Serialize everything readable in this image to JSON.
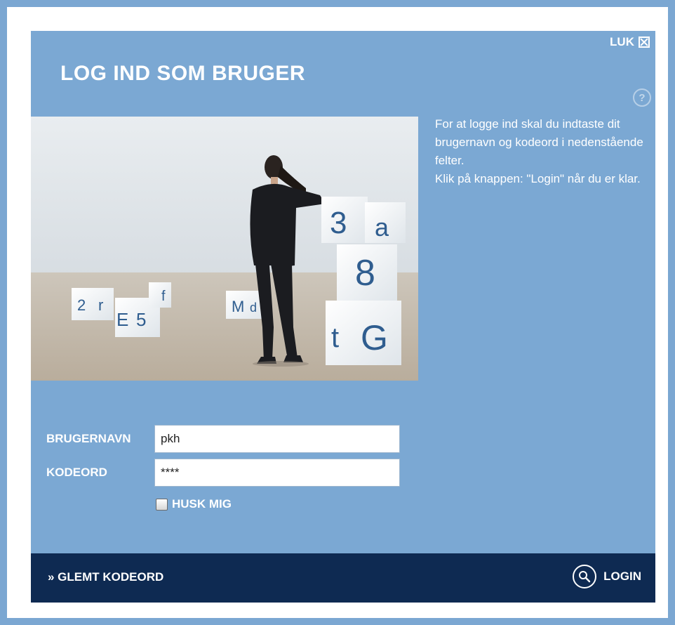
{
  "dialog": {
    "close_label": "LUK",
    "close_icon": "close-box-icon",
    "title": "LOG IND SOM BRUGER",
    "help_icon": "question-circle-icon",
    "help_glyph": "?"
  },
  "photo": {
    "description_icon": "photo-woman-with-letter-cubes",
    "cube_letters": [
      "3",
      "a",
      "8",
      "t",
      "G",
      "2",
      "r",
      "E",
      "5",
      "f",
      "M",
      "d"
    ]
  },
  "info": {
    "paragraph1": "For at logge ind skal du indtaste dit brugernavn og kodeord i nedenstående felter.",
    "paragraph2": "Klik på knappen: \"Login\" når du er klar."
  },
  "form": {
    "username_label": "BRUGERNAVN",
    "username_value": "pkh",
    "password_label": "KODEORD",
    "password_value": "****",
    "remember_label": "HUSK MIG",
    "remember_checked": false
  },
  "footer": {
    "forgot_label": "» GLEMT KODEORD",
    "login_label": "LOGIN",
    "login_icon": "magnifier-circle-icon"
  },
  "colors": {
    "panel": "#7ba8d3",
    "footer": "#0e2a52",
    "text": "#ffffff"
  }
}
